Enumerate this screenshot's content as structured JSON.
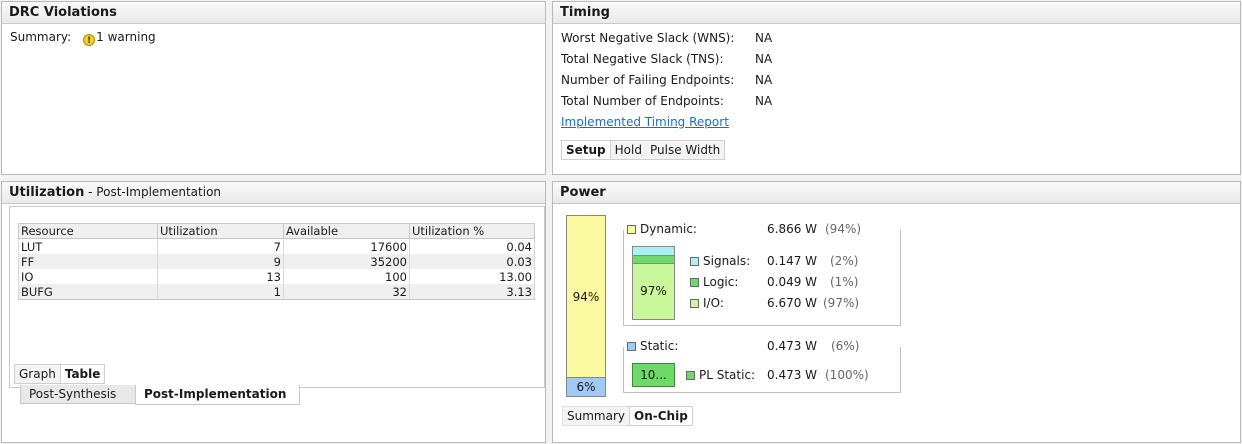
{
  "drc": {
    "title": "DRC Violations",
    "summary_label": "Summary:",
    "warning_icon_glyph": "!",
    "warning_text": "1 warning"
  },
  "timing": {
    "title": "Timing",
    "rows": [
      {
        "label": "Worst Negative Slack (WNS):",
        "value": "NA"
      },
      {
        "label": "Total Negative Slack (TNS):",
        "value": "NA"
      },
      {
        "label": "Number of Failing Endpoints:",
        "value": "NA"
      },
      {
        "label": "Total Number of Endpoints:",
        "value": "NA"
      }
    ],
    "report_link": "Implemented Timing Report",
    "tabs": [
      "Setup",
      "Hold",
      "Pulse Width"
    ],
    "active_tab": "Setup"
  },
  "utilization": {
    "title": "Utilization",
    "subtitle": " - Post-Implementation",
    "columns": [
      "Resource",
      "Utilization",
      "Available",
      "Utilization %"
    ],
    "rows": [
      [
        "LUT",
        "7",
        "17600",
        "0.04"
      ],
      [
        "FF",
        "9",
        "35200",
        "0.03"
      ],
      [
        "IO",
        "13",
        "100",
        "13.00"
      ],
      [
        "BUFG",
        "1",
        "32",
        "3.13"
      ]
    ],
    "view_tabs": [
      "Graph",
      "Table"
    ],
    "active_view_tab": "Table",
    "bottom_tabs": [
      "Post-Synthesis",
      "Post-Implementation"
    ],
    "active_bottom_tab": "Post-Implementation"
  },
  "power": {
    "title": "Power",
    "total_bar": {
      "dynamic_pct_label": "94%",
      "static_pct_label": "6%",
      "dynamic_fraction": 0.94,
      "static_fraction": 0.06
    },
    "dynamic": {
      "label": "Dynamic:",
      "value": "6.866 W",
      "pct": "(94%)",
      "color": "#fcfaa0"
    },
    "dynamic_bar_label": "97%",
    "signals": {
      "label": "Signals:",
      "value": "0.147 W",
      "pct": "(2%)",
      "color": "#a7f2f2"
    },
    "logic": {
      "label": "Logic:",
      "value": "0.049 W",
      "pct": "(1%)",
      "color": "#6fd86a"
    },
    "io": {
      "label": "I/O:",
      "value": "6.670 W",
      "pct": "(97%)",
      "color": "#c9f59b"
    },
    "static": {
      "label": "Static:",
      "value": "0.473 W",
      "pct": "(6%)",
      "color": "#9fcaf4"
    },
    "static_bar_label": "10...",
    "pl_static": {
      "label": "PL Static:",
      "value": "0.473 W",
      "pct": "(100%)",
      "color": "#6fd86a"
    },
    "tabs": [
      "Summary",
      "On-Chip"
    ],
    "active_tab": "On-Chip"
  }
}
